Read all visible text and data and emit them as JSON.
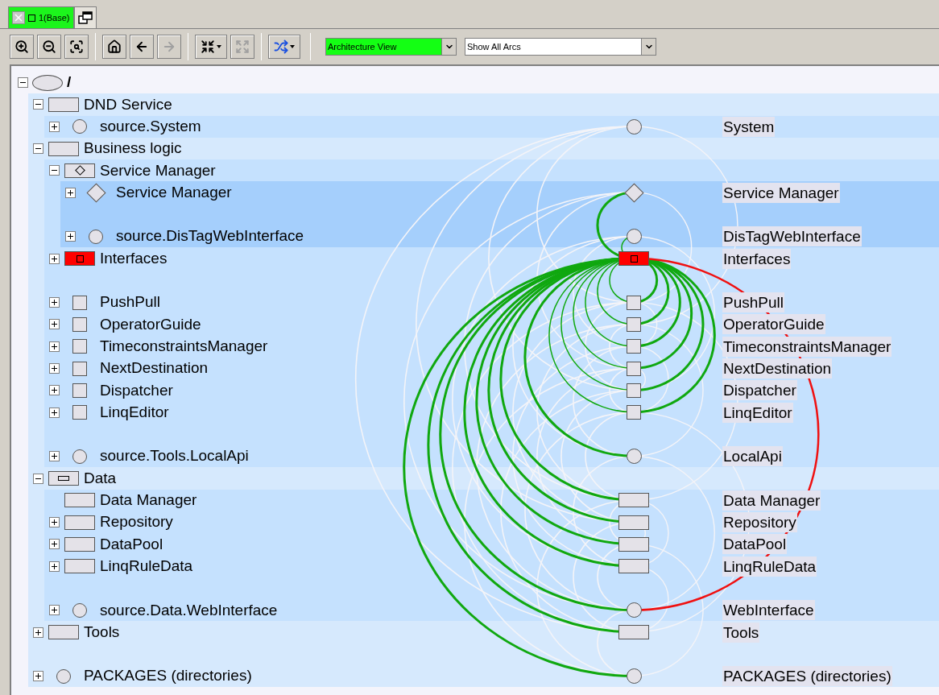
{
  "tabs": [
    {
      "label": "1(Base)",
      "selected": true
    },
    {
      "kind": "window",
      "selected": false
    }
  ],
  "toolbar": {
    "buttons": [
      {
        "kind": "zoom-in",
        "disabled": false
      },
      {
        "kind": "zoom-out",
        "disabled": false
      },
      {
        "kind": "fit",
        "disabled": false
      },
      {
        "kind": "home",
        "disabled": false
      },
      {
        "kind": "back",
        "disabled": false
      },
      {
        "kind": "forward",
        "disabled": true
      },
      {
        "kind": "cluster",
        "disabled": false
      },
      {
        "kind": "expand",
        "disabled": true
      },
      {
        "kind": "arcs",
        "disabled": false
      }
    ],
    "selects": [
      {
        "value": "Architecture View",
        "highlighted": true
      },
      {
        "value": "Show All Arcs",
        "highlighted": false
      }
    ]
  },
  "tree": {
    "label": "/",
    "expanded": true,
    "kind": "ellipse",
    "children": [
      {
        "label": "DND Service",
        "expanded": true,
        "kind": "box",
        "children": [
          {
            "label": "source.System",
            "expanded": false,
            "kind": "circle",
            "node": {
              "kind": "circle",
              "label": "System"
            }
          }
        ]
      },
      {
        "label": "Business logic",
        "expanded": true,
        "kind": "box",
        "children": [
          {
            "label": "Service Manager",
            "expanded": true,
            "kind": "diamond-box",
            "children": [
              {
                "label": "Service Manager",
                "expanded": false,
                "kind": "diamond",
                "selected": true,
                "node": {
                  "kind": "diamond",
                  "label": "Service Manager"
                }
              },
              {
                "label": "source.DisTagWebInterface",
                "expanded": false,
                "kind": "circle",
                "selected": true,
                "spaced_above": true,
                "node": {
                  "kind": "circle",
                  "label": "DisTagWebInterface"
                }
              }
            ]
          },
          {
            "label": "Interfaces",
            "expanded": false,
            "kind": "box",
            "focused": true,
            "node": {
              "kind": "box",
              "label": "Interfaces"
            }
          },
          {
            "label": "PushPull",
            "expanded": false,
            "kind": "square",
            "spaced_above": true,
            "node": {
              "kind": "square",
              "label": "PushPull"
            }
          },
          {
            "label": "OperatorGuide",
            "expanded": false,
            "kind": "square",
            "node": {
              "kind": "square",
              "label": "OperatorGuide"
            }
          },
          {
            "label": "TimeconstraintsManager",
            "expanded": false,
            "kind": "square",
            "node": {
              "kind": "square",
              "label": "TimeconstraintsManager"
            }
          },
          {
            "label": "NextDestination",
            "expanded": false,
            "kind": "square",
            "node": {
              "kind": "square",
              "label": "NextDestination"
            }
          },
          {
            "label": "Dispatcher",
            "expanded": false,
            "kind": "square",
            "node": {
              "kind": "square",
              "label": "Dispatcher"
            }
          },
          {
            "label": "LinqEditor",
            "expanded": false,
            "kind": "square",
            "node": {
              "kind": "square",
              "label": "LinqEditor"
            }
          },
          {
            "label": "source.Tools.LocalApi",
            "expanded": false,
            "kind": "circle",
            "spaced_above": true,
            "node": {
              "kind": "circle",
              "label": "LocalApi"
            }
          }
        ]
      },
      {
        "label": "Data",
        "expanded": true,
        "kind": "data-box",
        "children": [
          {
            "label": "Data Manager",
            "kind": "box",
            "node": {
              "kind": "box",
              "label": "Data Manager"
            }
          },
          {
            "label": "Repository",
            "expanded": false,
            "kind": "box",
            "node": {
              "kind": "box",
              "label": "Repository"
            }
          },
          {
            "label": "DataPool",
            "expanded": false,
            "kind": "box",
            "node": {
              "kind": "box",
              "label": "DataPool"
            }
          },
          {
            "label": "LinqRuleData",
            "expanded": false,
            "kind": "box",
            "node": {
              "kind": "box",
              "label": "LinqRuleData"
            }
          },
          {
            "label": "source.Data.WebInterface",
            "expanded": false,
            "kind": "circle",
            "spaced_above": true,
            "node": {
              "kind": "circle",
              "label": "WebInterface"
            }
          }
        ]
      },
      {
        "label": "Tools",
        "expanded": false,
        "kind": "box",
        "node": {
          "kind": "box",
          "label": "Tools"
        }
      },
      {
        "label": "PACKAGES (directories)",
        "expanded": false,
        "kind": "circle",
        "spaced_above": true,
        "node": {
          "kind": "circle",
          "label": "PACKAGES (directories)"
        }
      }
    ]
  }
}
